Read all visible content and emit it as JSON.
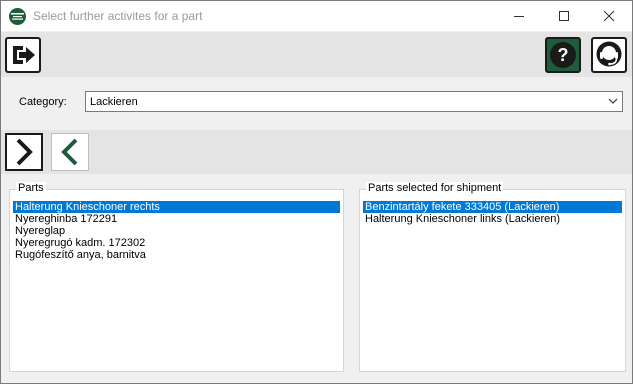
{
  "window": {
    "title": "Select further activites for a part"
  },
  "category": {
    "label": "Category:",
    "value": "Lackieren"
  },
  "parts": {
    "title": "Parts",
    "items": [
      "Halterung Knieschoner rechts",
      "Nyereghinba 172291",
      "Nyereglap",
      "Nyeregrugó kadm. 172302",
      "Rugófeszítő anya, barnitva"
    ],
    "selected_index": 0
  },
  "shipment": {
    "title": "Parts selected for shipment",
    "items": [
      "Benzintartály fekete 333405 (Lackieren)",
      "Halterung Knieschoner links (Lackieren)"
    ],
    "selected_index": 0
  },
  "icons": {
    "app": "app-logo-icon",
    "exit": "exit-icon",
    "help": "help-icon",
    "support": "support-headset-icon",
    "add": "chevron-right-icon",
    "remove": "chevron-left-icon",
    "dropdown": "chevron-down-icon",
    "minimize": "minimize-icon",
    "maximize": "maximize-icon",
    "close": "close-icon"
  },
  "colors": {
    "accent": "#0078d7",
    "brand_green": "#1f5c3a",
    "dark": "#1a1a1a"
  }
}
